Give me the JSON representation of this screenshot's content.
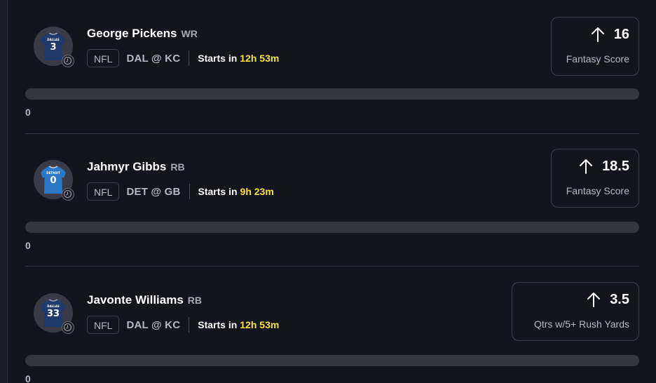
{
  "projections": [
    {
      "player_name": "George Pickens",
      "position": "WR",
      "league": "NFL",
      "matchup": "DAL @ KC",
      "starts_prefix": "Starts in",
      "countdown": "12h 53m",
      "jersey_number": "3",
      "jersey_color": "#1f3a6b",
      "jersey_text": "DALLAS",
      "direction_icon": "arrow-up-icon",
      "line_value": "16",
      "stat_label": "Fantasy Score",
      "progress_value": "0",
      "progress_fraction": 0
    },
    {
      "player_name": "Jahmyr Gibbs",
      "position": "RB",
      "league": "NFL",
      "matchup": "DET @ GB",
      "starts_prefix": "Starts in",
      "countdown": "9h 23m",
      "jersey_number": "0",
      "jersey_color": "#2a79c8",
      "jersey_text": "DETROIT",
      "direction_icon": "arrow-up-icon",
      "line_value": "18.5",
      "stat_label": "Fantasy Score",
      "progress_value": "0",
      "progress_fraction": 0
    },
    {
      "player_name": "Javonte Williams",
      "position": "RB",
      "league": "NFL",
      "matchup": "DAL @ KC",
      "starts_prefix": "Starts in",
      "countdown": "12h 53m",
      "jersey_number": "33",
      "jersey_color": "#1f3a6b",
      "jersey_text": "DALLAS",
      "direction_icon": "arrow-up-icon",
      "line_value": "3.5",
      "stat_label": "Qtrs w/5+ Rush Yards",
      "progress_value": "0",
      "progress_fraction": 0
    }
  ],
  "colors": {
    "background": "#14141c",
    "countdown": "#f6e33a",
    "muted_text": "#b8b8c2",
    "border": "#3f3f4b"
  }
}
